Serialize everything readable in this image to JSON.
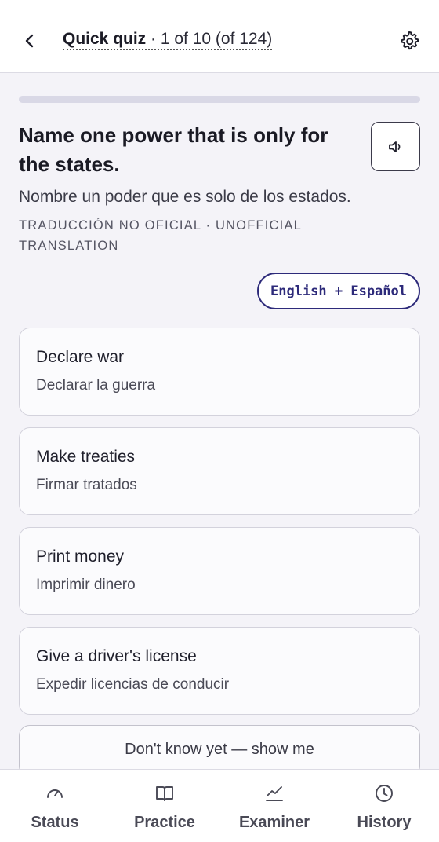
{
  "header": {
    "title_strong": "Quick quiz",
    "title_rest": " · 1 of 10 (of 124)",
    "back_icon": "chevron-left-icon",
    "settings_icon": "gear-icon"
  },
  "progress": {
    "fraction": 0.0
  },
  "question": {
    "text_en": "Name one power that is only for the states.",
    "text_es": "Nombre un poder que es solo de los estados.",
    "translation_note": "TRADUCCIÓN NO OFICIAL · UNOFFICIAL TRANSLATION",
    "audio_icon": "speaker-icon"
  },
  "language_toggle": {
    "label": "English + Español"
  },
  "options": [
    {
      "en": "Declare war",
      "es": "Declarar la guerra"
    },
    {
      "en": "Make treaties",
      "es": "Firmar tratados"
    },
    {
      "en": "Print money",
      "es": "Imprimir dinero"
    },
    {
      "en": "Give a driver's license",
      "es": "Expedir licencias de conducir"
    }
  ],
  "dont_know": {
    "label": "Don't know yet — show me"
  },
  "bottom_nav": {
    "items": [
      {
        "label": "Status",
        "icon": "gauge-icon"
      },
      {
        "label": "Practice",
        "icon": "book-icon"
      },
      {
        "label": "Examiner",
        "icon": "trend-chart-icon"
      },
      {
        "label": "History",
        "icon": "clock-icon"
      }
    ]
  },
  "colors": {
    "accent": "#2d2a7a",
    "background": "#f4f3f8",
    "card": "#fbfbfd"
  }
}
